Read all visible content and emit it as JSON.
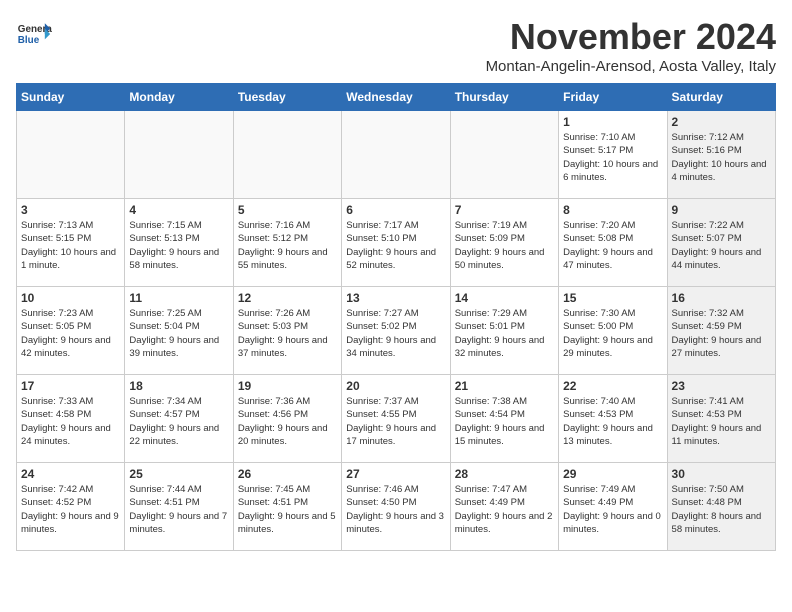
{
  "logo": {
    "general": "General",
    "blue": "Blue"
  },
  "header": {
    "month": "November 2024",
    "location": "Montan-Angelin-Arensod, Aosta Valley, Italy"
  },
  "weekdays": [
    "Sunday",
    "Monday",
    "Tuesday",
    "Wednesday",
    "Thursday",
    "Friday",
    "Saturday"
  ],
  "weeks": [
    [
      {
        "day": "",
        "info": "",
        "empty": true
      },
      {
        "day": "",
        "info": "",
        "empty": true
      },
      {
        "day": "",
        "info": "",
        "empty": true
      },
      {
        "day": "",
        "info": "",
        "empty": true
      },
      {
        "day": "",
        "info": "",
        "empty": true
      },
      {
        "day": "1",
        "info": "Sunrise: 7:10 AM\nSunset: 5:17 PM\nDaylight: 10 hours\nand 6 minutes.",
        "shaded": false
      },
      {
        "day": "2",
        "info": "Sunrise: 7:12 AM\nSunset: 5:16 PM\nDaylight: 10 hours\nand 4 minutes.",
        "shaded": true
      }
    ],
    [
      {
        "day": "3",
        "info": "Sunrise: 7:13 AM\nSunset: 5:15 PM\nDaylight: 10 hours\nand 1 minute.",
        "shaded": false
      },
      {
        "day": "4",
        "info": "Sunrise: 7:15 AM\nSunset: 5:13 PM\nDaylight: 9 hours\nand 58 minutes.",
        "shaded": false
      },
      {
        "day": "5",
        "info": "Sunrise: 7:16 AM\nSunset: 5:12 PM\nDaylight: 9 hours\nand 55 minutes.",
        "shaded": false
      },
      {
        "day": "6",
        "info": "Sunrise: 7:17 AM\nSunset: 5:10 PM\nDaylight: 9 hours\nand 52 minutes.",
        "shaded": false
      },
      {
        "day": "7",
        "info": "Sunrise: 7:19 AM\nSunset: 5:09 PM\nDaylight: 9 hours\nand 50 minutes.",
        "shaded": false
      },
      {
        "day": "8",
        "info": "Sunrise: 7:20 AM\nSunset: 5:08 PM\nDaylight: 9 hours\nand 47 minutes.",
        "shaded": false
      },
      {
        "day": "9",
        "info": "Sunrise: 7:22 AM\nSunset: 5:07 PM\nDaylight: 9 hours\nand 44 minutes.",
        "shaded": true
      }
    ],
    [
      {
        "day": "10",
        "info": "Sunrise: 7:23 AM\nSunset: 5:05 PM\nDaylight: 9 hours\nand 42 minutes.",
        "shaded": false
      },
      {
        "day": "11",
        "info": "Sunrise: 7:25 AM\nSunset: 5:04 PM\nDaylight: 9 hours\nand 39 minutes.",
        "shaded": false
      },
      {
        "day": "12",
        "info": "Sunrise: 7:26 AM\nSunset: 5:03 PM\nDaylight: 9 hours\nand 37 minutes.",
        "shaded": false
      },
      {
        "day": "13",
        "info": "Sunrise: 7:27 AM\nSunset: 5:02 PM\nDaylight: 9 hours\nand 34 minutes.",
        "shaded": false
      },
      {
        "day": "14",
        "info": "Sunrise: 7:29 AM\nSunset: 5:01 PM\nDaylight: 9 hours\nand 32 minutes.",
        "shaded": false
      },
      {
        "day": "15",
        "info": "Sunrise: 7:30 AM\nSunset: 5:00 PM\nDaylight: 9 hours\nand 29 minutes.",
        "shaded": false
      },
      {
        "day": "16",
        "info": "Sunrise: 7:32 AM\nSunset: 4:59 PM\nDaylight: 9 hours\nand 27 minutes.",
        "shaded": true
      }
    ],
    [
      {
        "day": "17",
        "info": "Sunrise: 7:33 AM\nSunset: 4:58 PM\nDaylight: 9 hours\nand 24 minutes.",
        "shaded": false
      },
      {
        "day": "18",
        "info": "Sunrise: 7:34 AM\nSunset: 4:57 PM\nDaylight: 9 hours\nand 22 minutes.",
        "shaded": false
      },
      {
        "day": "19",
        "info": "Sunrise: 7:36 AM\nSunset: 4:56 PM\nDaylight: 9 hours\nand 20 minutes.",
        "shaded": false
      },
      {
        "day": "20",
        "info": "Sunrise: 7:37 AM\nSunset: 4:55 PM\nDaylight: 9 hours\nand 17 minutes.",
        "shaded": false
      },
      {
        "day": "21",
        "info": "Sunrise: 7:38 AM\nSunset: 4:54 PM\nDaylight: 9 hours\nand 15 minutes.",
        "shaded": false
      },
      {
        "day": "22",
        "info": "Sunrise: 7:40 AM\nSunset: 4:53 PM\nDaylight: 9 hours\nand 13 minutes.",
        "shaded": false
      },
      {
        "day": "23",
        "info": "Sunrise: 7:41 AM\nSunset: 4:53 PM\nDaylight: 9 hours\nand 11 minutes.",
        "shaded": true
      }
    ],
    [
      {
        "day": "24",
        "info": "Sunrise: 7:42 AM\nSunset: 4:52 PM\nDaylight: 9 hours\nand 9 minutes.",
        "shaded": false
      },
      {
        "day": "25",
        "info": "Sunrise: 7:44 AM\nSunset: 4:51 PM\nDaylight: 9 hours\nand 7 minutes.",
        "shaded": false
      },
      {
        "day": "26",
        "info": "Sunrise: 7:45 AM\nSunset: 4:51 PM\nDaylight: 9 hours\nand 5 minutes.",
        "shaded": false
      },
      {
        "day": "27",
        "info": "Sunrise: 7:46 AM\nSunset: 4:50 PM\nDaylight: 9 hours\nand 3 minutes.",
        "shaded": false
      },
      {
        "day": "28",
        "info": "Sunrise: 7:47 AM\nSunset: 4:49 PM\nDaylight: 9 hours\nand 2 minutes.",
        "shaded": false
      },
      {
        "day": "29",
        "info": "Sunrise: 7:49 AM\nSunset: 4:49 PM\nDaylight: 9 hours\nand 0 minutes.",
        "shaded": false
      },
      {
        "day": "30",
        "info": "Sunrise: 7:50 AM\nSunset: 4:48 PM\nDaylight: 8 hours\nand 58 minutes.",
        "shaded": true
      }
    ]
  ]
}
